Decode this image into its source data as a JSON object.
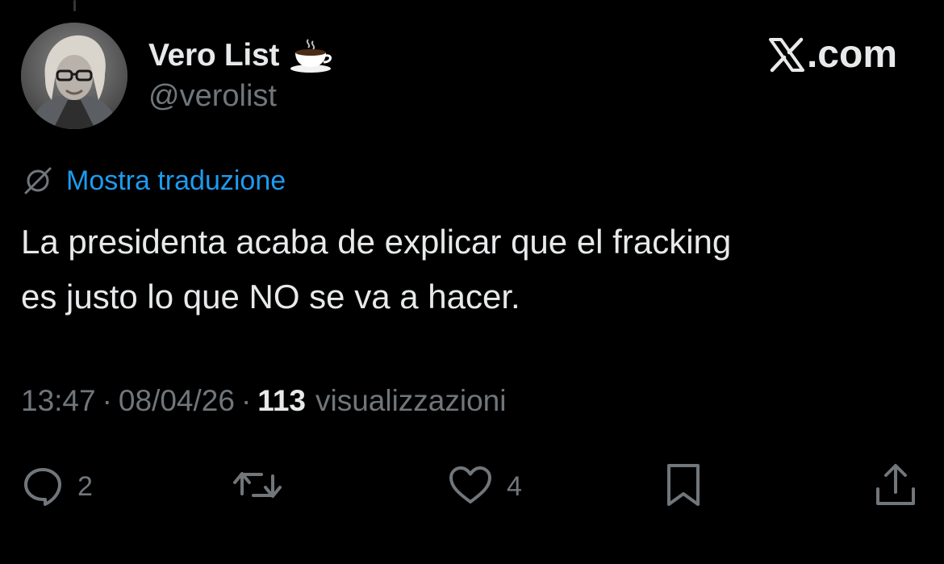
{
  "author": {
    "name": "Vero List",
    "name_emoji": "hot-beverage-icon",
    "handle": "@verolist",
    "avatar": "avatar"
  },
  "brand": {
    "label": ".com",
    "mark": "x-logo-icon"
  },
  "translate": {
    "icon": "globe-slash-icon",
    "label": "Mostra traduzione",
    "color": "#1d9bf0"
  },
  "tweet": {
    "lines": [
      "La presidenta acaba de explicar que el fracking",
      "es justo lo que NO se va a hacer."
    ]
  },
  "meta": {
    "time": "13:47",
    "date": "08/04/26",
    "separator": "·",
    "views_count": "113",
    "views_label": "visualizzazioni"
  },
  "actions": {
    "reply": {
      "icon": "reply-icon",
      "count": "2"
    },
    "repost": {
      "icon": "repost-icon"
    },
    "like": {
      "icon": "heart-icon",
      "count": "4"
    },
    "bookmark": {
      "icon": "bookmark-icon"
    },
    "share": {
      "icon": "share-icon"
    }
  },
  "colors": {
    "background": "#000000",
    "text_primary": "#e7e9ea",
    "text_secondary": "#71767b",
    "link": "#1d9bf0"
  }
}
